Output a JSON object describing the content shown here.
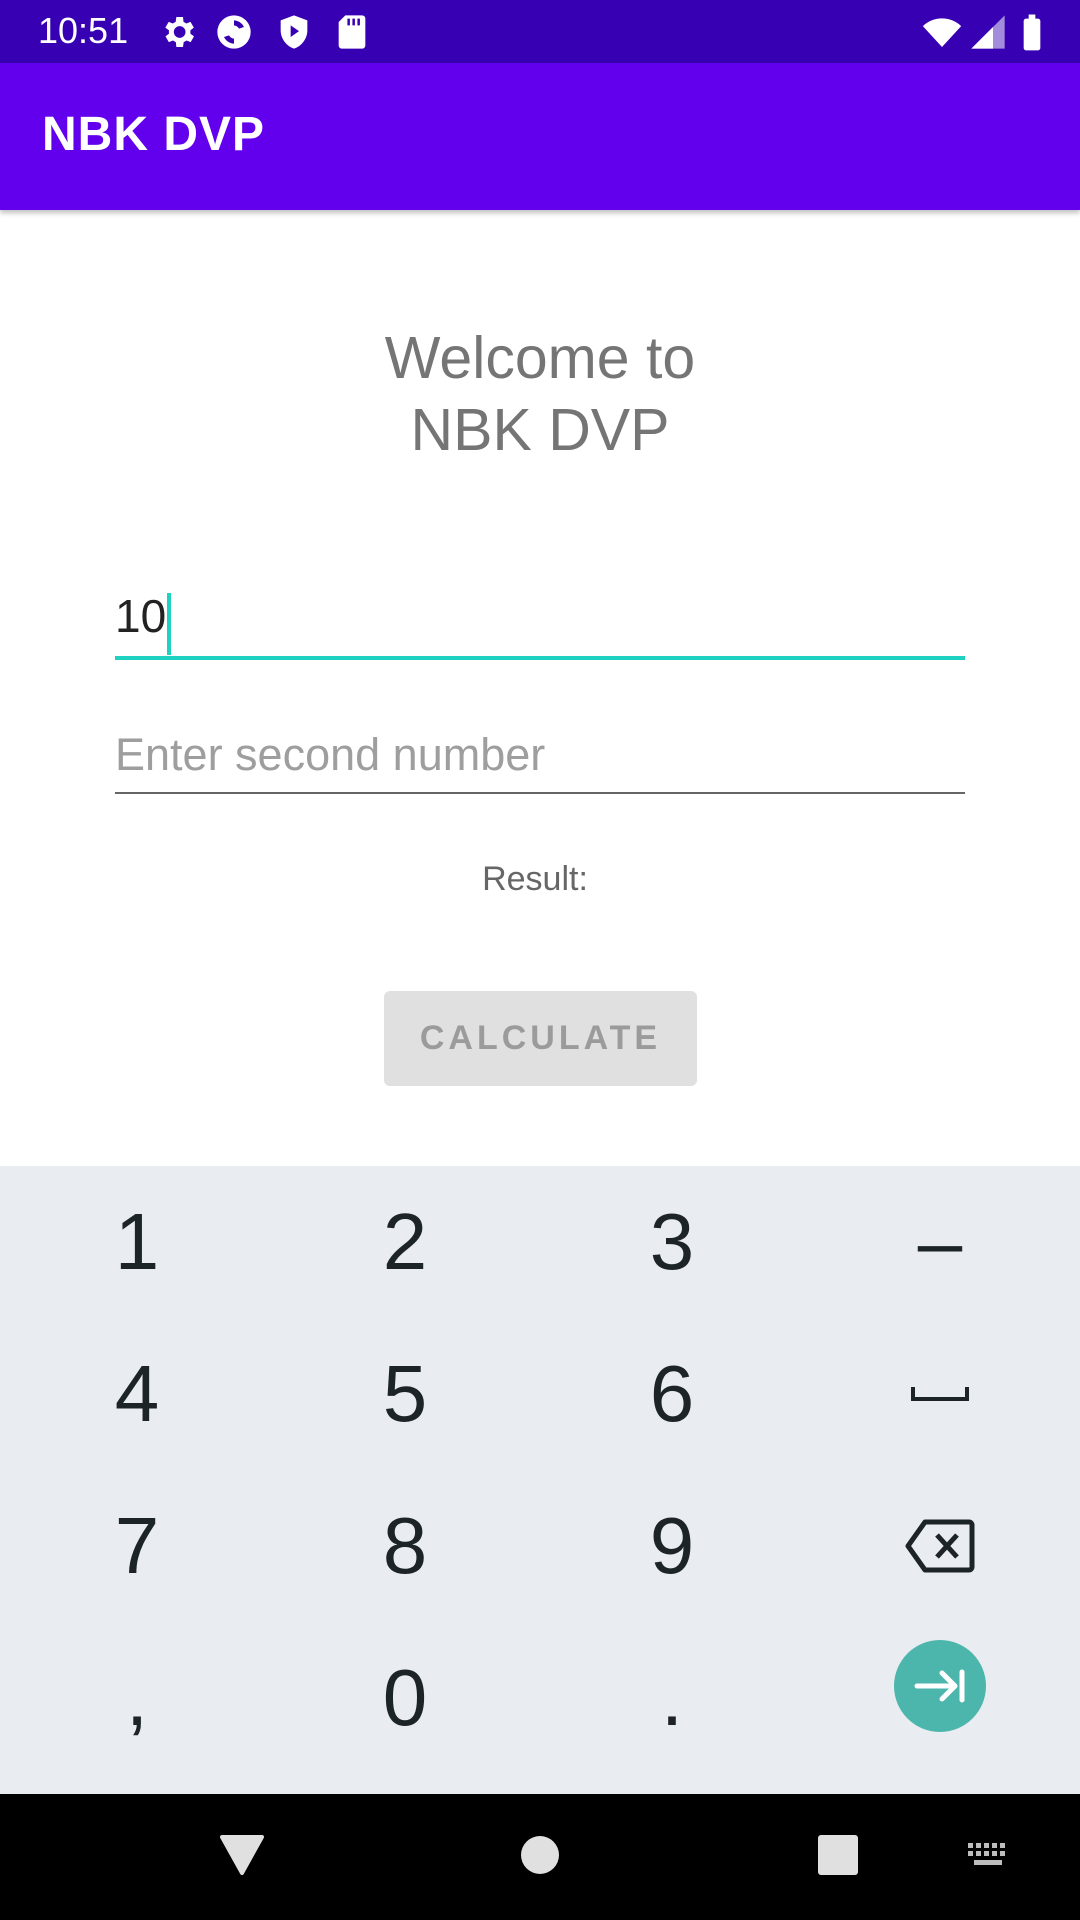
{
  "status_bar": {
    "time": "10:51",
    "icons_left": [
      "settings-icon",
      "sync-icon",
      "shield-icon",
      "sd-card-icon"
    ],
    "icons_right": [
      "wifi-icon",
      "signal-icon",
      "battery-icon"
    ]
  },
  "app_bar": {
    "title": "NBK DVP"
  },
  "main": {
    "welcome_line1": "Welcome to",
    "welcome_line2": "NBK DVP",
    "first_number": {
      "value": "10"
    },
    "second_number": {
      "value": "",
      "placeholder": "Enter second number"
    },
    "result_label": "Result:",
    "calculate_label": "CALCULATE"
  },
  "keyboard": {
    "rows": [
      [
        "1",
        "2",
        "3",
        "–"
      ],
      [
        "4",
        "5",
        "6",
        "space-icon"
      ],
      [
        "7",
        "8",
        "9",
        "backspace-icon"
      ],
      [
        ",",
        "0",
        ".",
        "next-icon"
      ]
    ]
  },
  "nav_bar": {
    "buttons": [
      "back-icon",
      "home-icon",
      "recents-icon",
      "keyboard-switch-icon"
    ]
  },
  "colors": {
    "status_bar": "#3700b3",
    "app_bar": "#6200ee",
    "accent": "#1fd1c1",
    "keyboard_bg": "#e9edf1",
    "enter_key": "#4db6ac"
  }
}
